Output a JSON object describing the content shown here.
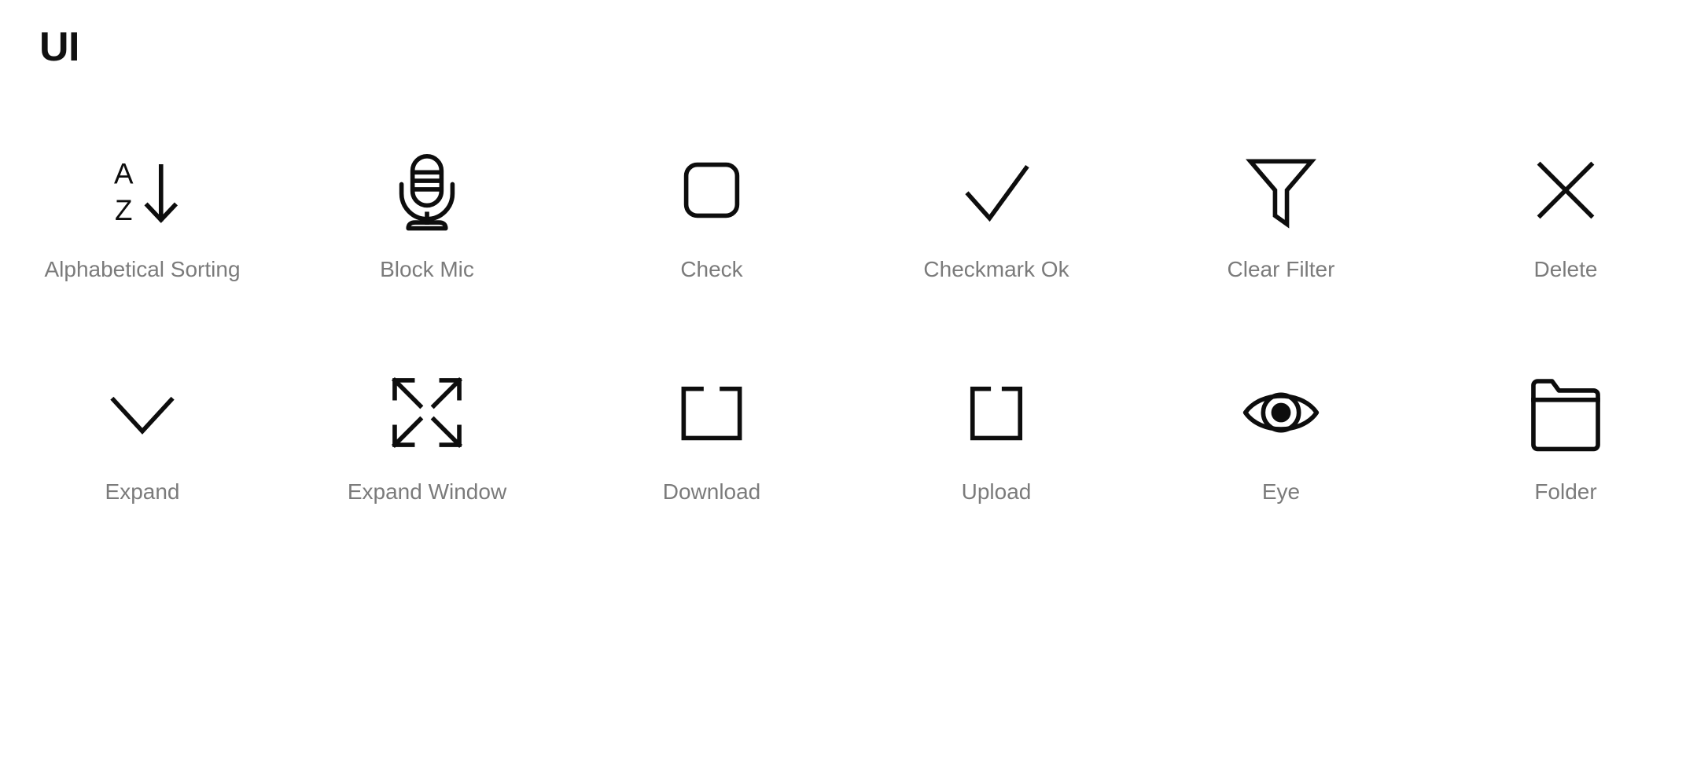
{
  "header": {
    "title": "UI"
  },
  "colors": {
    "background": "#ffffff",
    "title_text": "#111111",
    "icon_stroke": "#0d0d0d",
    "label_text": "#7b7b7b"
  },
  "gallery": {
    "columns": 6,
    "rows": 2,
    "icons": [
      {
        "name": "alphabetical-sorting-icon",
        "label": "Alphabetical Sorting",
        "letters": {
          "top": "A",
          "bottom": "Z"
        }
      },
      {
        "name": "block-mic-icon",
        "label": "Block Mic"
      },
      {
        "name": "check-icon",
        "label": "Check"
      },
      {
        "name": "checkmark-ok-icon",
        "label": "Checkmark Ok"
      },
      {
        "name": "clear-filter-icon",
        "label": "Clear Filter"
      },
      {
        "name": "delete-icon",
        "label": "Delete"
      },
      {
        "name": "expand-icon",
        "label": "Expand"
      },
      {
        "name": "expand-window-icon",
        "label": "Expand Window"
      },
      {
        "name": "download-icon",
        "label": "Download"
      },
      {
        "name": "upload-icon",
        "label": "Upload"
      },
      {
        "name": "eye-icon",
        "label": "Eye"
      },
      {
        "name": "folder-icon",
        "label": "Folder"
      }
    ]
  }
}
